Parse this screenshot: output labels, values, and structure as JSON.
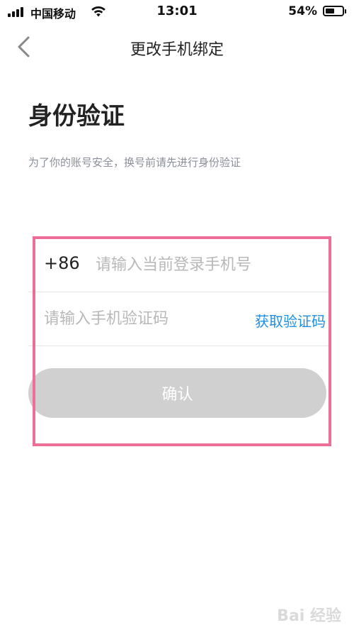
{
  "status_bar": {
    "carrier": "中国移动",
    "time": "13:01",
    "battery_percent": "54%",
    "battery_level": 0.54,
    "icons": [
      "signal-icon",
      "wifi-icon",
      "battery-icon"
    ]
  },
  "nav": {
    "title": "更改手机绑定",
    "back_icon": "chevron-left-icon"
  },
  "page": {
    "title": "身份验证",
    "subtitle": "为了你的账号安全，换号前请先进行身份验证"
  },
  "form": {
    "phone_prefix": "+86",
    "phone_value": "",
    "phone_placeholder": "请输入当前登录手机号",
    "code_value": "",
    "code_placeholder": "请输入手机验证码",
    "get_code_label": "获取验证码",
    "confirm_label": "确认"
  },
  "watermark": "Bai 经验",
  "colors": {
    "accent": "#1e8fe6",
    "button_disabled": "#d0d0d0",
    "highlight": "#ee6e98",
    "subtitle": "#8a8f99"
  }
}
